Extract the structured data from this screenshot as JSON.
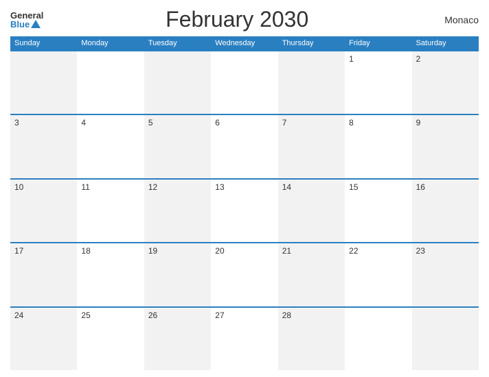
{
  "logo": {
    "general": "General",
    "blue": "Blue"
  },
  "title": "February 2030",
  "country": "Monaco",
  "days": [
    "Sunday",
    "Monday",
    "Tuesday",
    "Wednesday",
    "Thursday",
    "Friday",
    "Saturday"
  ],
  "weeks": [
    [
      {
        "num": "",
        "empty": true
      },
      {
        "num": "",
        "empty": true
      },
      {
        "num": "",
        "empty": true
      },
      {
        "num": "",
        "empty": true
      },
      {
        "num": "",
        "empty": true
      },
      {
        "num": "1",
        "empty": false
      },
      {
        "num": "2",
        "empty": false
      }
    ],
    [
      {
        "num": "3",
        "empty": false
      },
      {
        "num": "4",
        "empty": false
      },
      {
        "num": "5",
        "empty": false
      },
      {
        "num": "6",
        "empty": false
      },
      {
        "num": "7",
        "empty": false
      },
      {
        "num": "8",
        "empty": false
      },
      {
        "num": "9",
        "empty": false
      }
    ],
    [
      {
        "num": "10",
        "empty": false
      },
      {
        "num": "11",
        "empty": false
      },
      {
        "num": "12",
        "empty": false
      },
      {
        "num": "13",
        "empty": false
      },
      {
        "num": "14",
        "empty": false
      },
      {
        "num": "15",
        "empty": false
      },
      {
        "num": "16",
        "empty": false
      }
    ],
    [
      {
        "num": "17",
        "empty": false
      },
      {
        "num": "18",
        "empty": false
      },
      {
        "num": "19",
        "empty": false
      },
      {
        "num": "20",
        "empty": false
      },
      {
        "num": "21",
        "empty": false
      },
      {
        "num": "22",
        "empty": false
      },
      {
        "num": "23",
        "empty": false
      }
    ],
    [
      {
        "num": "24",
        "empty": false
      },
      {
        "num": "25",
        "empty": false
      },
      {
        "num": "26",
        "empty": false
      },
      {
        "num": "27",
        "empty": false
      },
      {
        "num": "28",
        "empty": false
      },
      {
        "num": "",
        "empty": true
      },
      {
        "num": "",
        "empty": true
      }
    ]
  ],
  "colors": {
    "header_bg": "#2a7fc1",
    "alt_row": "#f2f2f2"
  }
}
